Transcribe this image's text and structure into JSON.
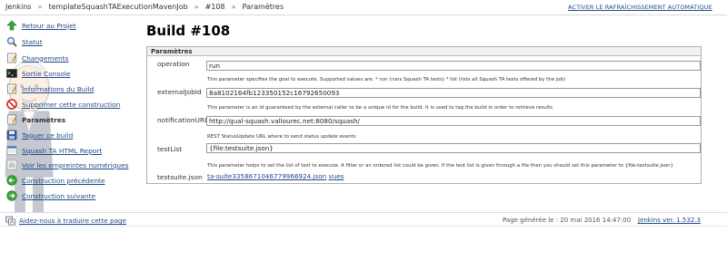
{
  "breadcrumb": {
    "items": [
      "Jenkins",
      "templateSquashTAExecutionMavenJob",
      "#108",
      "Paramètres"
    ],
    "separator": "»"
  },
  "header": {
    "auto_refresh": "ACTIVER LE RAFRAÎCHISSEMENT AUTOMATIQUE"
  },
  "sidebar": {
    "items": [
      {
        "label": "Retour au Projet",
        "icon": "up-arrow-icon"
      },
      {
        "label": "Statut",
        "icon": "search-icon"
      },
      {
        "label": "Changements",
        "icon": "notepad-icon"
      },
      {
        "label": "Sortie Console",
        "icon": "terminal-icon"
      },
      {
        "label": "Informations du Build",
        "icon": "notepad-icon"
      },
      {
        "label": "Supprimer cette construction",
        "icon": "no-entry-icon"
      },
      {
        "label": "Paramètres",
        "icon": "notepad-icon"
      },
      {
        "label": "Taguer ce build",
        "icon": "save-icon"
      },
      {
        "label": "Squash TA HTML Report",
        "icon": "report-icon"
      },
      {
        "label": "Voir les empreintes numériques",
        "icon": "fingerprint-icon"
      },
      {
        "label": "Construction précédente",
        "icon": "arrow-left-icon"
      },
      {
        "label": "Construction suivante",
        "icon": "arrow-right-icon"
      }
    ],
    "current_index": 6
  },
  "main": {
    "title": "Build #108",
    "section_title": "Paramètres",
    "params": [
      {
        "name": "operation",
        "value": "run",
        "description": "This parameter specifies the goal to execute. Supported values are: * run (runs Squash TA tests) * list (lists all Squash TA tests offered by the job)"
      },
      {
        "name": "externalJobId",
        "value": "8a8102164fb123350152c16792650093",
        "description": "This parameter is an id guaranteed by the external caller to be a unique id for the build. It is used to tag the build in order to retrieve results"
      },
      {
        "name": "notificationURL",
        "value": "http://qual-squash.vallourec.net:8080/squash/",
        "description": "REST StatusUpdate URL where to send status update events"
      },
      {
        "name": "testList",
        "value": "{file:testsuite.json}",
        "description": "This parameter helps to set the list of test to execute. A filter or an ordered list could be given. If the test list is given through a file then you should set this parameter to {file:testsuite.json}"
      },
      {
        "name": "testsuite.json",
        "file_link": "ta-suite3358671046779966924.json",
        "view_link": "vues"
      }
    ]
  },
  "footer": {
    "translate": "Aidez-nous à traduire cette page",
    "generated": "Page générée le : 20 mai 2016 14:47:00",
    "version": "Jenkins ver. 1.532.3"
  },
  "colors": {
    "link": "#204a87",
    "border": "#b0b0b0",
    "header_bg": "#f0f0f0"
  }
}
